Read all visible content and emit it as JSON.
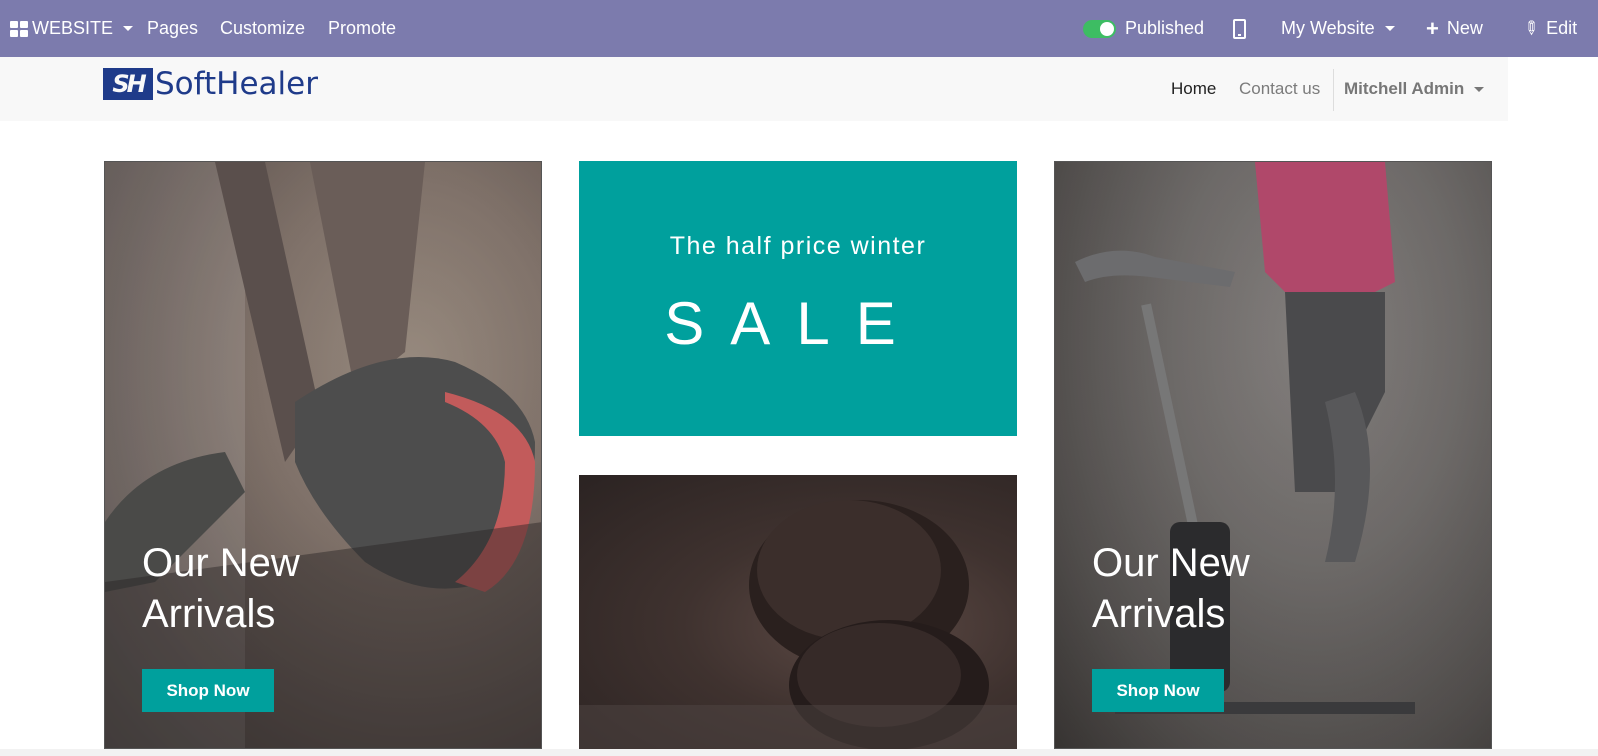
{
  "adminbar": {
    "app_label": "WEBSITE",
    "menu": [
      "Pages",
      "Customize",
      "Promote"
    ],
    "published_label": "Published",
    "website_label": "My Website",
    "new_label": "New",
    "edit_label": "Edit",
    "published": true
  },
  "header": {
    "logo_text": "SoftHealer",
    "logo_mark": "SH",
    "nav": [
      "Home",
      "Contact us"
    ],
    "user": "Mitchell Admin"
  },
  "cards": {
    "left": {
      "title_line1": "Our New",
      "title_line2": "Arrivals",
      "button": "Shop Now"
    },
    "sale": {
      "subtitle": "The half price winter",
      "title": "SALE"
    },
    "right": {
      "title_line1": "Our New",
      "title_line2": "Arrivals",
      "button": "Shop Now"
    }
  },
  "colors": {
    "adminbar": "#7c7bad",
    "accent": "#00a09d",
    "logo": "#1f3b8a",
    "toggle_on": "#3dbd63"
  }
}
